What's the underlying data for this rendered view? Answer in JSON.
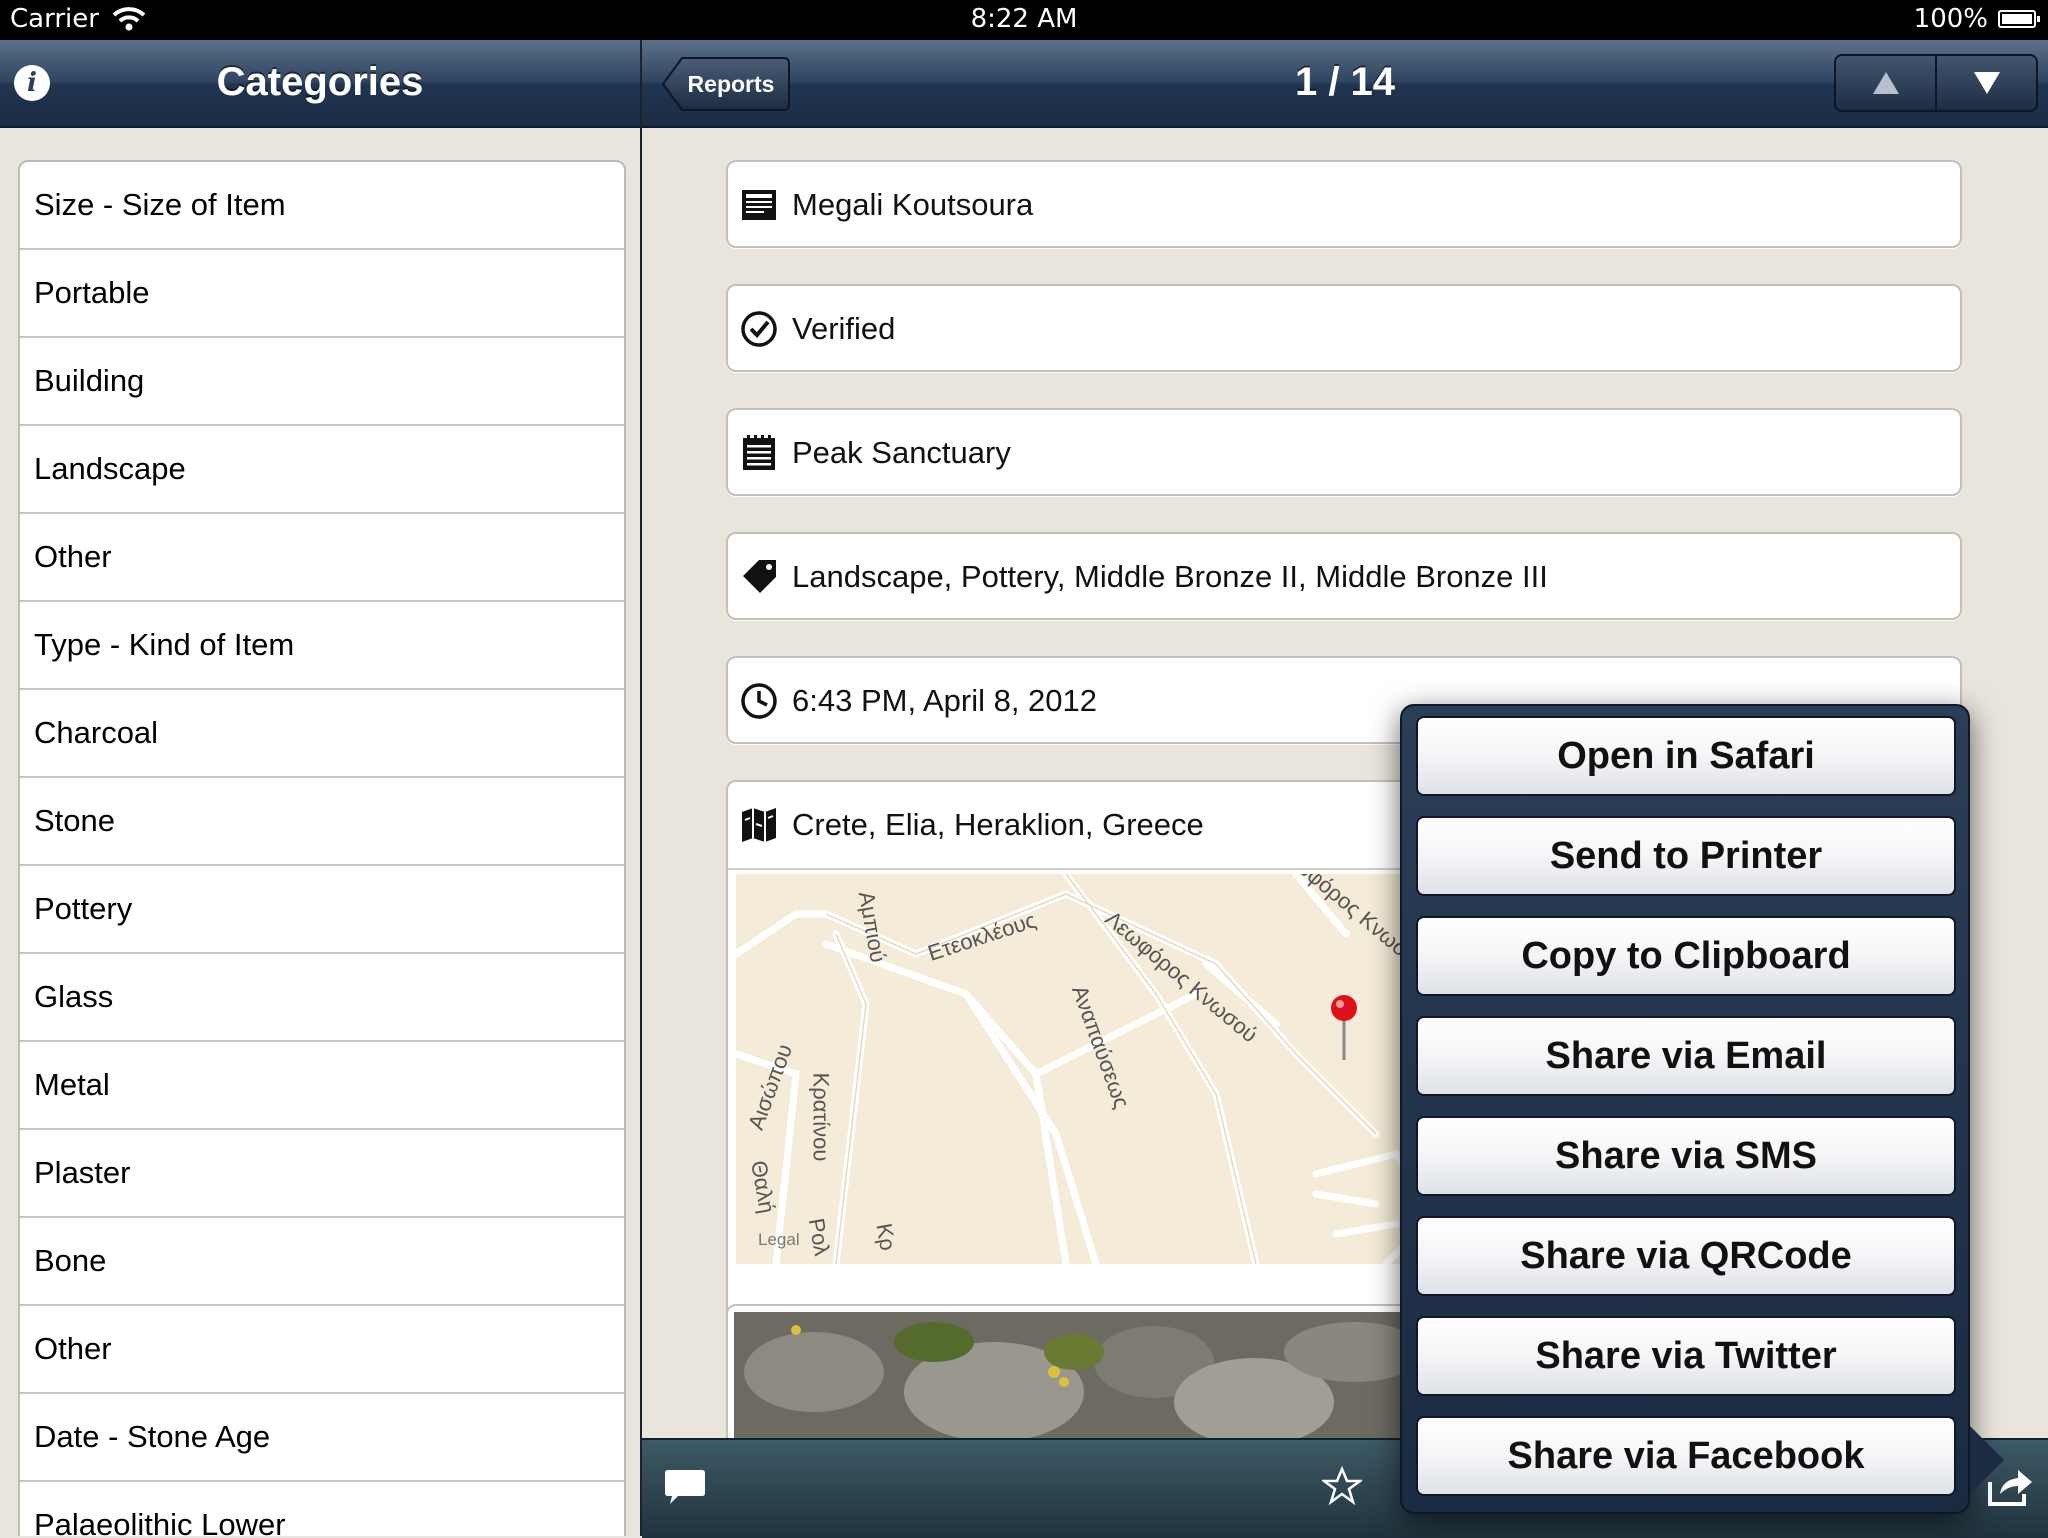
{
  "status_bar": {
    "carrier": "Carrier",
    "time": "8:22 AM",
    "battery": "100%"
  },
  "left_nav": {
    "title": "Categories",
    "info_icon": "info-icon"
  },
  "right_nav": {
    "back_label": "Reports",
    "position": "1 / 14",
    "prev_icon": "triangle-up-icon",
    "next_icon": "triangle-down-icon"
  },
  "categories": [
    "Size - Size of Item",
    "Portable",
    "Building",
    "Landscape",
    "Other",
    "Type - Kind of Item",
    "Charcoal",
    "Stone",
    "Pottery",
    "Glass",
    "Metal",
    "Plaster",
    "Bone",
    "Other",
    "Date - Stone Age",
    "Palaeolithic Lower"
  ],
  "report": {
    "title": "Megali Koutsoura",
    "status": "Verified",
    "description": "Peak Sanctuary",
    "tags": "Landscape, Pottery, Middle Bronze II, Middle Bronze III",
    "datetime": "6:43 PM, April 8, 2012",
    "location": "Crete, Elia, Heraklion, Greece"
  },
  "map": {
    "legal": "Legal",
    "street_labels": [
      "Ετεοκλέους",
      "Λεωφόρος Κνωσού",
      "Αναπαύσεως",
      "Αισώπου",
      "Κρατίνου",
      "Θαλή",
      "Αμπιού",
      "Κρ",
      "Ρολ",
      "Λεωφόρος Κνωσού"
    ]
  },
  "share_menu": [
    "Open in Safari",
    "Send to Printer",
    "Copy to Clipboard",
    "Share via Email",
    "Share via SMS",
    "Share via QRCode",
    "Share via Twitter",
    "Share via Facebook"
  ],
  "toolbar": {
    "comment_icon": "comment-icon",
    "star_icon": "star-icon",
    "share_icon": "share-icon"
  },
  "colors": {
    "accent_nav": "#203550",
    "background": "#e9e5dc",
    "map_bg": "#f4ecd8",
    "pin": "#e0101a"
  }
}
